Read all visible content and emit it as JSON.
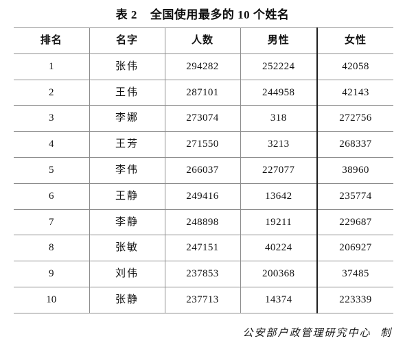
{
  "title": "表 2    全国使用最多的 10 个姓名",
  "credit": "公安部户政管理研究中心  制",
  "table": {
    "columns": [
      {
        "key": "rank",
        "label": "排名"
      },
      {
        "key": "name",
        "label": "名字"
      },
      {
        "key": "total",
        "label": "人数"
      },
      {
        "key": "male",
        "label": "男性"
      },
      {
        "key": "female",
        "label": "女性"
      }
    ],
    "rows": [
      {
        "rank": "1",
        "name": "张伟",
        "total": "294282",
        "male": "252224",
        "female": "42058"
      },
      {
        "rank": "2",
        "name": "王伟",
        "total": "287101",
        "male": "244958",
        "female": "42143"
      },
      {
        "rank": "3",
        "name": "李娜",
        "total": "273074",
        "male": "318",
        "female": "272756"
      },
      {
        "rank": "4",
        "name": "王芳",
        "total": "271550",
        "male": "3213",
        "female": "268337"
      },
      {
        "rank": "5",
        "name": "李伟",
        "total": "266037",
        "male": "227077",
        "female": "38960"
      },
      {
        "rank": "6",
        "name": "王静",
        "total": "249416",
        "male": "13642",
        "female": "235774"
      },
      {
        "rank": "7",
        "name": "李静",
        "total": "248898",
        "male": "19211",
        "female": "229687"
      },
      {
        "rank": "8",
        "name": "张敏",
        "total": "247151",
        "male": "40224",
        "female": "206927"
      },
      {
        "rank": "9",
        "name": "刘伟",
        "total": "237853",
        "male": "200368",
        "female": "37485"
      },
      {
        "rank": "10",
        "name": "张静",
        "total": "237713",
        "male": "14374",
        "female": "223339"
      }
    ]
  },
  "chart_data": {
    "type": "table",
    "title": "表 2    全国使用最多的 10 个姓名",
    "columns": [
      "排名",
      "名字",
      "人数",
      "男性",
      "女性"
    ],
    "rows": [
      [
        "1",
        "张伟",
        294282,
        252224,
        42058
      ],
      [
        "2",
        "王伟",
        287101,
        244958,
        42143
      ],
      [
        "3",
        "李娜",
        273074,
        318,
        272756
      ],
      [
        "4",
        "王芳",
        271550,
        3213,
        268337
      ],
      [
        "5",
        "李伟",
        266037,
        227077,
        38960
      ],
      [
        "6",
        "王静",
        249416,
        13642,
        235774
      ],
      [
        "7",
        "李静",
        248898,
        19211,
        229687
      ],
      [
        "8",
        "张敏",
        247151,
        40224,
        206927
      ],
      [
        "9",
        "刘伟",
        237853,
        200368,
        37485
      ],
      [
        "10",
        "张静",
        237713,
        14374,
        223339
      ]
    ],
    "annotations": [
      "公安部户政管理研究中心  制"
    ]
  }
}
